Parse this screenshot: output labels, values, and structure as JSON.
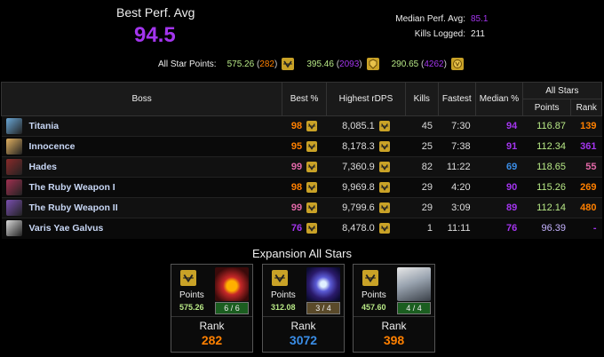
{
  "header": {
    "best_label": "Best Perf. Avg",
    "best_value": "94.5",
    "median_label": "Median Perf. Avg:",
    "median_value": "85.1",
    "kills_label": "Kills Logged:",
    "kills_value": "211"
  },
  "all_star": {
    "label": "All Star Points:",
    "groups": [
      {
        "points": "575.26",
        "rank": "282",
        "icon": "ultimate-icon"
      },
      {
        "points": "395.46",
        "rank": "2093",
        "icon": "gold-shield-icon"
      },
      {
        "points": "290.65",
        "rank": "4262",
        "icon": "gold-emblem-icon"
      }
    ]
  },
  "table": {
    "headers": {
      "boss": "Boss",
      "best": "Best %",
      "rdps": "Highest rDPS",
      "kills": "Kills",
      "fastest": "Fastest",
      "median": "Median %",
      "allstars": "All Stars",
      "points": "Points",
      "rank": "Rank"
    },
    "rows": [
      {
        "boss": "Titania",
        "best": "98",
        "rdps": "8,085.1",
        "kills": "45",
        "fastest": "7:30",
        "median": "94",
        "points": "116.87",
        "rank": "139",
        "best_color": "orange",
        "median_color": "purple",
        "rank_color": "orange",
        "icon_color": "#6aa7d6"
      },
      {
        "boss": "Innocence",
        "best": "95",
        "rdps": "8,178.3",
        "kills": "25",
        "fastest": "7:38",
        "median": "91",
        "points": "112.34",
        "rank": "361",
        "best_color": "orange",
        "median_color": "purple",
        "rank_color": "purple",
        "icon_color": "#e0b060"
      },
      {
        "boss": "Hades",
        "best": "99",
        "rdps": "7,360.9",
        "kills": "82",
        "fastest": "11:22",
        "median": "69",
        "points": "118.65",
        "rank": "55",
        "best_color": "pink",
        "median_color": "blue",
        "rank_color": "pink",
        "icon_color": "#8a2a2a"
      },
      {
        "boss": "The Ruby Weapon I",
        "best": "98",
        "rdps": "9,969.8",
        "kills": "29",
        "fastest": "4:20",
        "median": "90",
        "points": "115.26",
        "rank": "269",
        "best_color": "orange",
        "median_color": "purple",
        "rank_color": "orange",
        "icon_color": "#a03050"
      },
      {
        "boss": "The Ruby Weapon II",
        "best": "99",
        "rdps": "9,799.6",
        "kills": "29",
        "fastest": "3:09",
        "median": "89",
        "points": "112.14",
        "rank": "480",
        "best_color": "pink",
        "median_color": "purple",
        "rank_color": "orange",
        "icon_color": "#7a4fb0"
      },
      {
        "boss": "Varis Yae Galvus",
        "best": "76",
        "rdps": "8,478.0",
        "kills": "1",
        "fastest": "11:11",
        "median": "76",
        "points": "96.39",
        "rank": "-",
        "best_color": "purple",
        "median_color": "purple",
        "rank_color": "purple",
        "points_color": "lav",
        "icon_color": "#d8d8d8"
      }
    ]
  },
  "expansion": {
    "title": "Expansion All Stars",
    "cards": [
      {
        "points_label": "Points",
        "points": "575.26",
        "progress": "6 / 6",
        "complete": true,
        "rank_label": "Rank",
        "rank": "282",
        "rank_color": "#ff8000",
        "art": "savage-mask-art"
      },
      {
        "points_label": "Points",
        "points": "312.08",
        "progress": "3 / 4",
        "complete": false,
        "rank_label": "Rank",
        "rank": "3072",
        "rank_color": "#3a8de6",
        "art": "crystal-orb-art"
      },
      {
        "points_label": "Points",
        "points": "457.60",
        "progress": "4 / 4",
        "complete": true,
        "rank_label": "Rank",
        "rank": "398",
        "rank_color": "#ff8000",
        "art": "silver-dragon-art"
      }
    ]
  }
}
